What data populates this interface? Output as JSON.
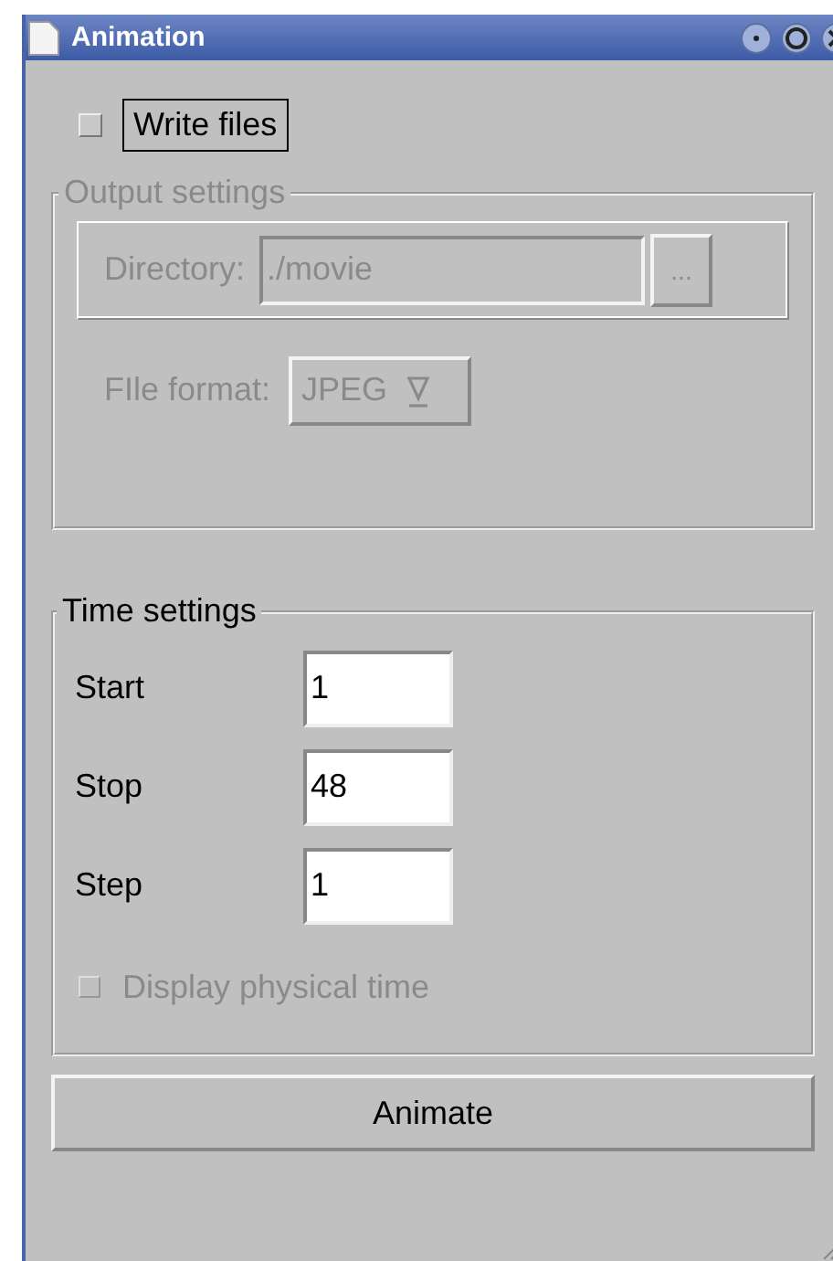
{
  "window": {
    "title": "Animation"
  },
  "write_files": {
    "label": "Write files",
    "checked": false
  },
  "output_settings": {
    "title": "Output settings",
    "disabled": true,
    "directory": {
      "label": "Directory:",
      "value": "./movie",
      "browse": "..."
    },
    "file_format": {
      "label": "FIle format:",
      "value": "JPEG"
    }
  },
  "time_settings": {
    "title": "Time settings",
    "fields": [
      {
        "label": "Start",
        "value": "1"
      },
      {
        "label": "Stop",
        "value": "48"
      },
      {
        "label": "Step",
        "value": "1"
      }
    ],
    "display_physical_time": {
      "label": "Display physical time",
      "checked": false,
      "disabled": true
    }
  },
  "buttons": [
    "Animate"
  ]
}
